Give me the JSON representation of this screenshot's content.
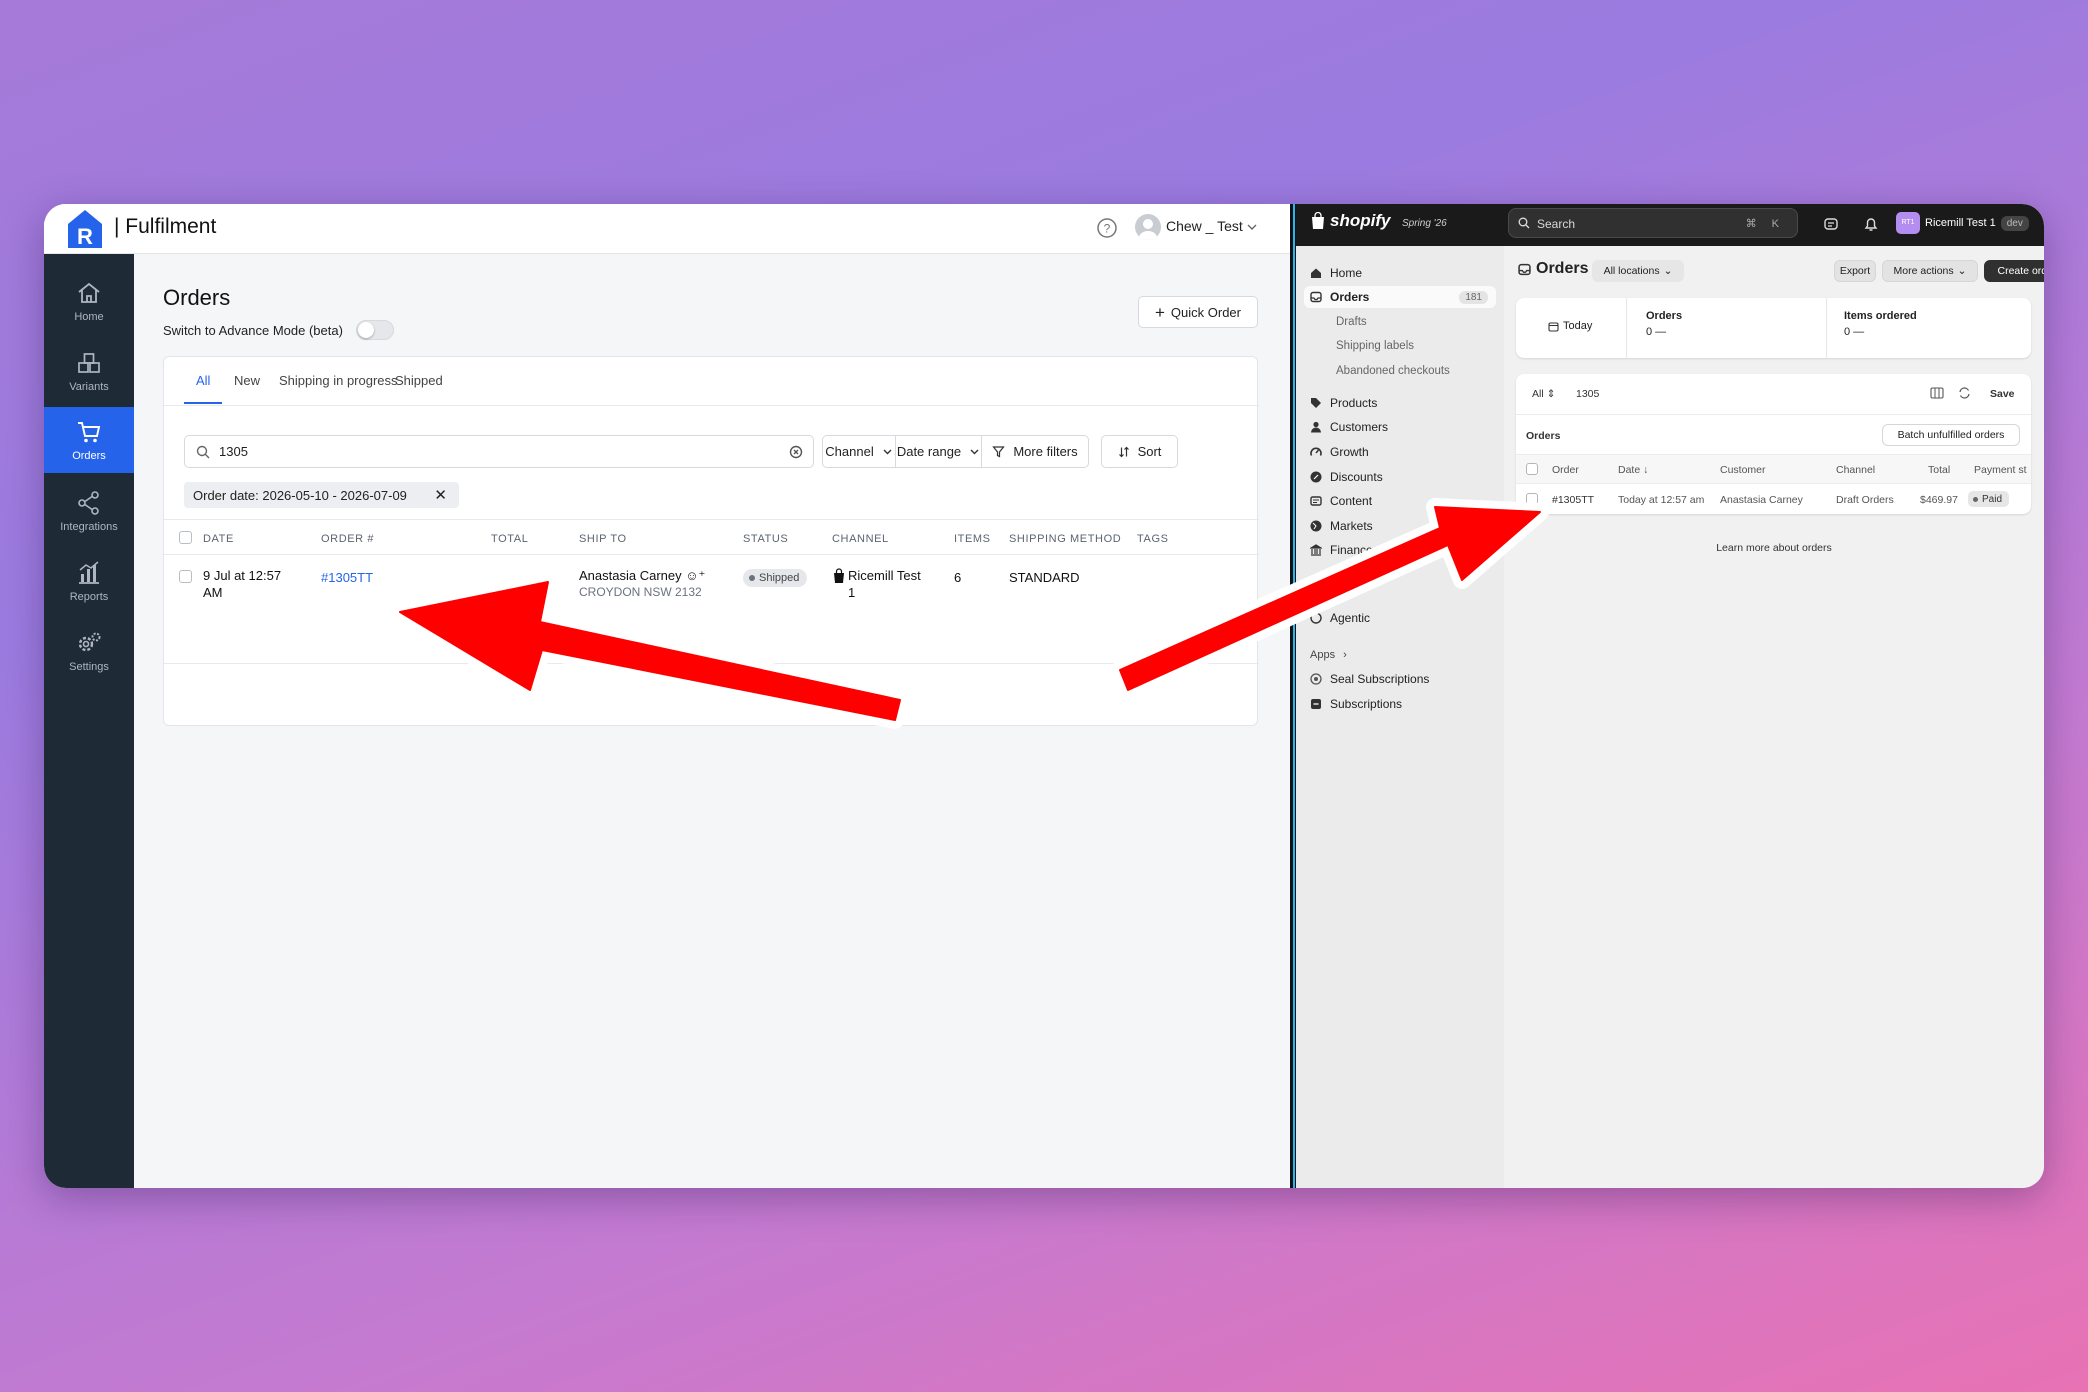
{
  "left_app": {
    "brand": "| Fulfilment",
    "user": "Chew _ Test",
    "nav": [
      {
        "label": "Home",
        "icon": "home-icon"
      },
      {
        "label": "Variants",
        "icon": "boxes-icon"
      },
      {
        "label": "Orders",
        "icon": "cart-icon"
      },
      {
        "label": "Integrations",
        "icon": "share-icon"
      },
      {
        "label": "Reports",
        "icon": "chart-icon"
      },
      {
        "label": "Settings",
        "icon": "gears-icon"
      }
    ],
    "title": "Orders",
    "advance_mode_label": "Switch to Advance Mode (beta)",
    "quick_order": "Quick Order",
    "tabs": [
      "All",
      "New",
      "Shipping in progress",
      "Shipped"
    ],
    "search_value": "1305",
    "filters": {
      "channel": "Channel",
      "date_range": "Date range",
      "more": "More filters",
      "sort": "Sort"
    },
    "chip": "Order date: 2026-05-10 - 2026-07-09",
    "columns": [
      "DATE",
      "ORDER #",
      "TOTAL",
      "SHIP TO",
      "STATUS",
      "CHANNEL",
      "ITEMS",
      "SHIPPING METHOD",
      "TAGS"
    ],
    "row": {
      "date_line1": "9 Jul at 12:57",
      "date_line2": "AM",
      "order": "#1305TT",
      "ship_name": "Anastasia Carney",
      "ship_addr": "CROYDON NSW 2132",
      "status": "Shipped",
      "channel_line1": "Ricemill Test",
      "channel_line2": "1",
      "items": "6",
      "shipping": "STANDARD"
    }
  },
  "right_app": {
    "brand": "shopify",
    "edition": "Spring '26",
    "search_placeholder": "Search",
    "search_keys": "⌘ K",
    "store_initials": "RT1",
    "store": "Ricemill Test 1",
    "store_badge": "dev",
    "sidebar": [
      {
        "label": "Home",
        "icon": "home-icon"
      },
      {
        "label": "Orders",
        "icon": "inbox-icon",
        "count": "181"
      },
      {
        "label": "Drafts",
        "sub": true
      },
      {
        "label": "Shipping labels",
        "sub": true
      },
      {
        "label": "Abandoned checkouts",
        "sub": true
      },
      {
        "label": "Products",
        "icon": "tag-icon"
      },
      {
        "label": "Customers",
        "icon": "person-icon"
      },
      {
        "label": "Growth",
        "icon": "gauge-icon"
      },
      {
        "label": "Discounts",
        "icon": "discount-icon"
      },
      {
        "label": "Content",
        "icon": "content-icon"
      },
      {
        "label": "Markets",
        "icon": "globe-icon"
      },
      {
        "label": "Finance",
        "icon": "bank-icon"
      },
      {
        "label": "Agentic",
        "icon": "agent-icon"
      },
      {
        "label": "Apps",
        "chevron": "›"
      },
      {
        "label": "Seal Subscriptions",
        "icon": "seal-icon"
      },
      {
        "label": "Subscriptions",
        "icon": "subscriptions-icon"
      }
    ],
    "title": "Orders",
    "locations": "All locations",
    "export": "Export",
    "more_actions": "More actions",
    "create_order": "Create order",
    "today": "Today",
    "stats": [
      {
        "label": "Orders",
        "value": "0 —"
      },
      {
        "label": "Items ordered",
        "value": "0 —"
      }
    ],
    "view": "All",
    "search_value": "1305",
    "save": "Save",
    "orders_label": "Orders",
    "batch": "Batch unfulfilled orders",
    "columns": [
      "Order",
      "Date ↓",
      "Customer",
      "Channel",
      "Total",
      "Payment st"
    ],
    "row": {
      "order": "#1305TT",
      "date": "Today at 12:57 am",
      "customer": "Anastasia Carney",
      "channel": "Draft Orders",
      "total": "$469.97",
      "payment": "Paid"
    },
    "learn_more": "Learn more about orders"
  },
  "colors": {
    "accent_blue": "#2563eb",
    "sidebar_dark": "#1f2a37",
    "arrow_red": "#ff0000",
    "shopify_dark": "#1a1a1a"
  }
}
